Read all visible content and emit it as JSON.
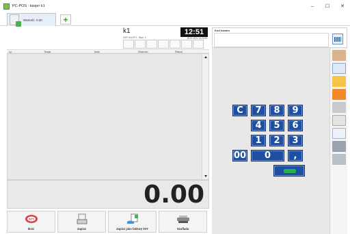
{
  "window": {
    "title": "PC-POS : kasjer k1"
  },
  "window_controls": {
    "minimize": "–",
    "maximize": "☐",
    "close": "✕"
  },
  "tabs": {
    "receipt_tab_label": "Wartość: 0.00",
    "add_tab_symbol": "+"
  },
  "receipt_header": {
    "name": "k1",
    "subtitle": "SZP, M.ŁRTL, Stan. 1",
    "time": "12:51",
    "date": "05.01.2021 14:23:05"
  },
  "table": {
    "columns": [
      "Lp",
      "Towar",
      "Ilość",
      "Wartość",
      "Rabat"
    ]
  },
  "total": {
    "value": "0.00"
  },
  "bottom_buttons": [
    {
      "label": "Ilość",
      "icon": "quantity-icon"
    },
    {
      "label": "Zapisz",
      "icon": "receipt-save-icon"
    },
    {
      "label": "Zapisz jako fakturę VAT",
      "icon": "invoice-icon"
    },
    {
      "label": "Szuflada",
      "icon": "cash-drawer-icon"
    }
  ],
  "barcode": {
    "label": "Kod towaru",
    "value": "",
    "placeholder": ""
  },
  "keypad": {
    "keys": [
      "C",
      "7",
      "8",
      "9",
      "4",
      "5",
      "6",
      "1",
      "2",
      "3",
      "00",
      "0",
      ","
    ],
    "ok_icon": "checkmark-icon"
  },
  "side_icons": [
    "building-icon",
    "barcode-grid-icon",
    "folder-icon",
    "discount-icon",
    "tools-icon",
    "document-pen-icon",
    "list-icon",
    "register-icon",
    "scale-icon"
  ],
  "colors": {
    "keypad_blue": "#1f4fa3",
    "ok_green": "#2cb24a",
    "tab_bg": "#e6eef8",
    "clock_bg": "#111111"
  }
}
